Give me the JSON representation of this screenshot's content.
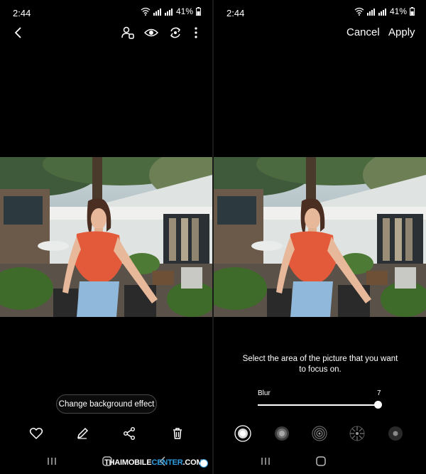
{
  "status_bar": {
    "time": "2:44",
    "battery": "41%"
  },
  "left_panel": {
    "toolbar": {
      "back_icon": "back-chevron-icon",
      "icons": [
        "portrait-person-icon",
        "eye-icon",
        "rotate-refresh-icon",
        "more-vertical-icon"
      ]
    },
    "change_background_effect": "Change background effect",
    "actions": [
      "heart-icon",
      "pencil-icon",
      "share-icon",
      "trash-icon"
    ]
  },
  "right_panel": {
    "header": {
      "cancel": "Cancel",
      "apply": "Apply"
    },
    "instruction": "Select the area of the picture that you want to focus on.",
    "slider": {
      "label": "Blur",
      "value": "7",
      "level": 1.0
    },
    "effects": [
      "blur-effect-icon",
      "big-circle-effect-icon",
      "spin-effect-icon",
      "zoom-effect-icon",
      "color-point-effect-icon"
    ]
  },
  "navigation": [
    "recent-apps-icon",
    "home-icon",
    "back-icon"
  ],
  "watermark": {
    "prefix": "THAIMOBILE",
    "highlight": "CENTER",
    "suffix": ".COM"
  },
  "colors": {
    "background": "#000000",
    "shirt": "#e25a3a",
    "watermark_accent": "#2f9ee0"
  }
}
